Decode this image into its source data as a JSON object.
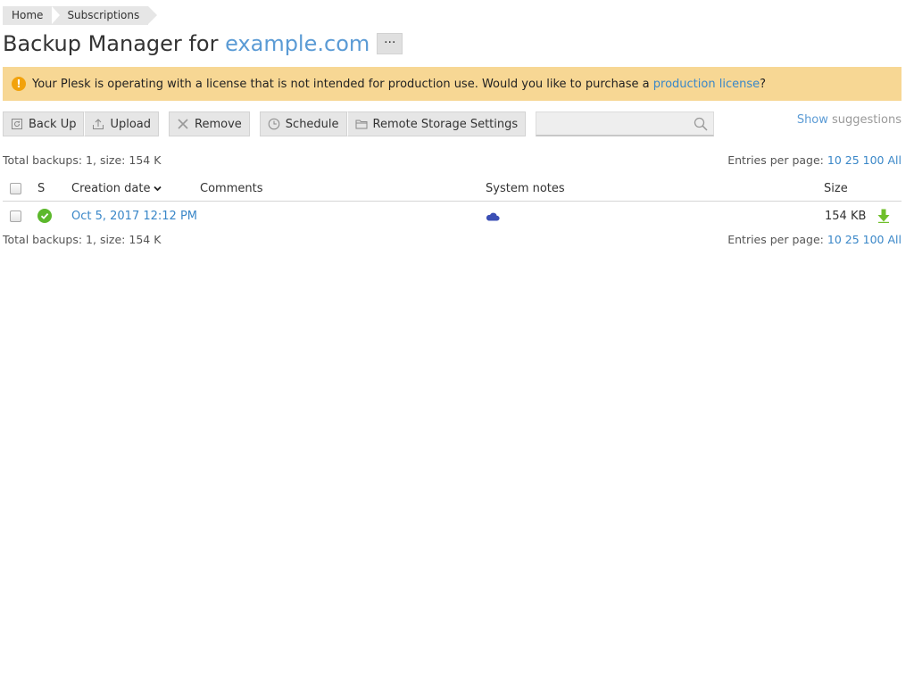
{
  "breadcrumb": [
    {
      "label": "Home"
    },
    {
      "label": "Subscriptions"
    }
  ],
  "title": {
    "prefix": "Backup Manager for ",
    "domain": "example.com",
    "more_label": "···"
  },
  "alert": {
    "text": "Your Plesk is operating with a license that is not intended for production use. Would you like to purchase a ",
    "link": "production license",
    "suffix": "?",
    "icon_glyph": "!"
  },
  "toolbar": {
    "back_up": "Back Up",
    "upload": "Upload",
    "remove": "Remove",
    "schedule": "Schedule",
    "remote_storage": "Remote Storage Settings",
    "search_placeholder": ""
  },
  "suggestions": {
    "show": "Show",
    "rest": " suggestions"
  },
  "summary": {
    "text": "Total backups: 1, size: 154 K"
  },
  "pagination": {
    "label": "Entries per page: ",
    "options": [
      "10",
      "25",
      "100",
      "All"
    ]
  },
  "table": {
    "columns": {
      "status": "S",
      "creation_date": "Creation date",
      "comments": "Comments",
      "system_notes": "System notes",
      "size": "Size"
    },
    "rows": [
      {
        "creation_date": "Oct 5, 2017 12:12 PM",
        "comments": "",
        "size": "154 KB",
        "status_icon": "success-check-icon",
        "note_icon": "cloud-icon"
      }
    ]
  },
  "colors": {
    "link": "#3a87c8",
    "alert_bg": "#f7d794",
    "success": "#5cb82c",
    "download": "#6fbf2a",
    "cloud": "#3b4fb5"
  }
}
